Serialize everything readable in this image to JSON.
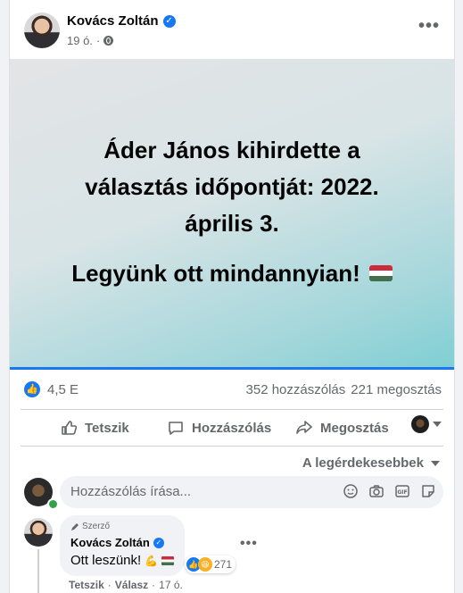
{
  "post": {
    "author": "Kovács Zoltán",
    "time": "19 ó.",
    "more_label": "•••",
    "banner": {
      "title": "Áder János kihirdette a választás időpontját: 2022. április 3.",
      "subtitle": "Legyünk ott mindannyian!"
    }
  },
  "stats": {
    "likes": "4,5 E",
    "comments": "352 hozzászólás",
    "shares": "221 megosztás"
  },
  "actions": {
    "like": "Tetszik",
    "comment": "Hozzászólás",
    "share": "Megosztás"
  },
  "comments_section": {
    "sort_label": "A legérdekesebbek",
    "placeholder": "Hozzászólás írása...",
    "comment": {
      "badge": "Szerző",
      "author": "Kovács Zoltán",
      "text": "Ott leszünk!",
      "reaction_count": "271",
      "like_action": "Tetszik",
      "reply_action": "Válasz",
      "time": "17 ó.",
      "separator": "·"
    }
  },
  "colors": {
    "accent": "#1877f2",
    "text_secondary": "#65676b",
    "online": "#31a24c"
  },
  "icons": [
    "verified-icon",
    "globe-icon",
    "like-icon",
    "comment-icon",
    "share-icon",
    "emoji-icon",
    "camera-icon",
    "gif-icon",
    "sticker-icon",
    "pen-icon"
  ]
}
